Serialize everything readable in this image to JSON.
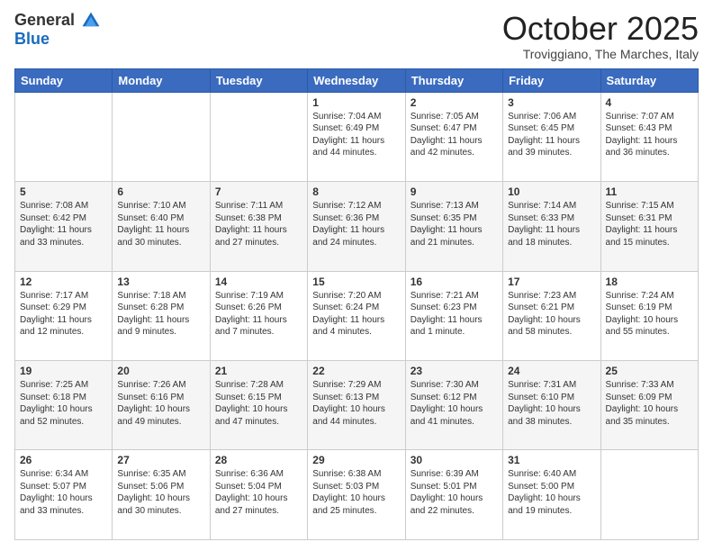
{
  "logo": {
    "general": "General",
    "blue": "Blue"
  },
  "header": {
    "month": "October 2025",
    "location": "Troviggiano, The Marches, Italy"
  },
  "days": [
    "Sunday",
    "Monday",
    "Tuesday",
    "Wednesday",
    "Thursday",
    "Friday",
    "Saturday"
  ],
  "weeks": [
    [
      {
        "day": "",
        "sunrise": "",
        "sunset": "",
        "daylight": ""
      },
      {
        "day": "",
        "sunrise": "",
        "sunset": "",
        "daylight": ""
      },
      {
        "day": "",
        "sunrise": "",
        "sunset": "",
        "daylight": ""
      },
      {
        "day": "1",
        "sunrise": "Sunrise: 7:04 AM",
        "sunset": "Sunset: 6:49 PM",
        "daylight": "Daylight: 11 hours and 44 minutes."
      },
      {
        "day": "2",
        "sunrise": "Sunrise: 7:05 AM",
        "sunset": "Sunset: 6:47 PM",
        "daylight": "Daylight: 11 hours and 42 minutes."
      },
      {
        "day": "3",
        "sunrise": "Sunrise: 7:06 AM",
        "sunset": "Sunset: 6:45 PM",
        "daylight": "Daylight: 11 hours and 39 minutes."
      },
      {
        "day": "4",
        "sunrise": "Sunrise: 7:07 AM",
        "sunset": "Sunset: 6:43 PM",
        "daylight": "Daylight: 11 hours and 36 minutes."
      }
    ],
    [
      {
        "day": "5",
        "sunrise": "Sunrise: 7:08 AM",
        "sunset": "Sunset: 6:42 PM",
        "daylight": "Daylight: 11 hours and 33 minutes."
      },
      {
        "day": "6",
        "sunrise": "Sunrise: 7:10 AM",
        "sunset": "Sunset: 6:40 PM",
        "daylight": "Daylight: 11 hours and 30 minutes."
      },
      {
        "day": "7",
        "sunrise": "Sunrise: 7:11 AM",
        "sunset": "Sunset: 6:38 PM",
        "daylight": "Daylight: 11 hours and 27 minutes."
      },
      {
        "day": "8",
        "sunrise": "Sunrise: 7:12 AM",
        "sunset": "Sunset: 6:36 PM",
        "daylight": "Daylight: 11 hours and 24 minutes."
      },
      {
        "day": "9",
        "sunrise": "Sunrise: 7:13 AM",
        "sunset": "Sunset: 6:35 PM",
        "daylight": "Daylight: 11 hours and 21 minutes."
      },
      {
        "day": "10",
        "sunrise": "Sunrise: 7:14 AM",
        "sunset": "Sunset: 6:33 PM",
        "daylight": "Daylight: 11 hours and 18 minutes."
      },
      {
        "day": "11",
        "sunrise": "Sunrise: 7:15 AM",
        "sunset": "Sunset: 6:31 PM",
        "daylight": "Daylight: 11 hours and 15 minutes."
      }
    ],
    [
      {
        "day": "12",
        "sunrise": "Sunrise: 7:17 AM",
        "sunset": "Sunset: 6:29 PM",
        "daylight": "Daylight: 11 hours and 12 minutes."
      },
      {
        "day": "13",
        "sunrise": "Sunrise: 7:18 AM",
        "sunset": "Sunset: 6:28 PM",
        "daylight": "Daylight: 11 hours and 9 minutes."
      },
      {
        "day": "14",
        "sunrise": "Sunrise: 7:19 AM",
        "sunset": "Sunset: 6:26 PM",
        "daylight": "Daylight: 11 hours and 7 minutes."
      },
      {
        "day": "15",
        "sunrise": "Sunrise: 7:20 AM",
        "sunset": "Sunset: 6:24 PM",
        "daylight": "Daylight: 11 hours and 4 minutes."
      },
      {
        "day": "16",
        "sunrise": "Sunrise: 7:21 AM",
        "sunset": "Sunset: 6:23 PM",
        "daylight": "Daylight: 11 hours and 1 minute."
      },
      {
        "day": "17",
        "sunrise": "Sunrise: 7:23 AM",
        "sunset": "Sunset: 6:21 PM",
        "daylight": "Daylight: 10 hours and 58 minutes."
      },
      {
        "day": "18",
        "sunrise": "Sunrise: 7:24 AM",
        "sunset": "Sunset: 6:19 PM",
        "daylight": "Daylight: 10 hours and 55 minutes."
      }
    ],
    [
      {
        "day": "19",
        "sunrise": "Sunrise: 7:25 AM",
        "sunset": "Sunset: 6:18 PM",
        "daylight": "Daylight: 10 hours and 52 minutes."
      },
      {
        "day": "20",
        "sunrise": "Sunrise: 7:26 AM",
        "sunset": "Sunset: 6:16 PM",
        "daylight": "Daylight: 10 hours and 49 minutes."
      },
      {
        "day": "21",
        "sunrise": "Sunrise: 7:28 AM",
        "sunset": "Sunset: 6:15 PM",
        "daylight": "Daylight: 10 hours and 47 minutes."
      },
      {
        "day": "22",
        "sunrise": "Sunrise: 7:29 AM",
        "sunset": "Sunset: 6:13 PM",
        "daylight": "Daylight: 10 hours and 44 minutes."
      },
      {
        "day": "23",
        "sunrise": "Sunrise: 7:30 AM",
        "sunset": "Sunset: 6:12 PM",
        "daylight": "Daylight: 10 hours and 41 minutes."
      },
      {
        "day": "24",
        "sunrise": "Sunrise: 7:31 AM",
        "sunset": "Sunset: 6:10 PM",
        "daylight": "Daylight: 10 hours and 38 minutes."
      },
      {
        "day": "25",
        "sunrise": "Sunrise: 7:33 AM",
        "sunset": "Sunset: 6:09 PM",
        "daylight": "Daylight: 10 hours and 35 minutes."
      }
    ],
    [
      {
        "day": "26",
        "sunrise": "Sunrise: 6:34 AM",
        "sunset": "Sunset: 5:07 PM",
        "daylight": "Daylight: 10 hours and 33 minutes."
      },
      {
        "day": "27",
        "sunrise": "Sunrise: 6:35 AM",
        "sunset": "Sunset: 5:06 PM",
        "daylight": "Daylight: 10 hours and 30 minutes."
      },
      {
        "day": "28",
        "sunrise": "Sunrise: 6:36 AM",
        "sunset": "Sunset: 5:04 PM",
        "daylight": "Daylight: 10 hours and 27 minutes."
      },
      {
        "day": "29",
        "sunrise": "Sunrise: 6:38 AM",
        "sunset": "Sunset: 5:03 PM",
        "daylight": "Daylight: 10 hours and 25 minutes."
      },
      {
        "day": "30",
        "sunrise": "Sunrise: 6:39 AM",
        "sunset": "Sunset: 5:01 PM",
        "daylight": "Daylight: 10 hours and 22 minutes."
      },
      {
        "day": "31",
        "sunrise": "Sunrise: 6:40 AM",
        "sunset": "Sunset: 5:00 PM",
        "daylight": "Daylight: 10 hours and 19 minutes."
      },
      {
        "day": "",
        "sunrise": "",
        "sunset": "",
        "daylight": ""
      }
    ]
  ]
}
